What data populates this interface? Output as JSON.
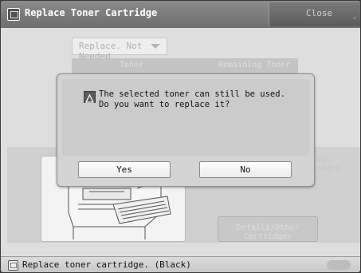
{
  "window": {
    "title": "Replace Toner Cartridge",
    "close_label": "Close"
  },
  "background": {
    "dropdown_value": "Replace. Not Needed",
    "column_toner": "Toner",
    "column_remaining": "Remaining Toner",
    "side_text": "ical orders",
    "details_button": "Details/Other Cartridges"
  },
  "dialog": {
    "line1": "The selected toner can still be used.",
    "line2": "Do you want to replace it?",
    "yes_label": "Yes",
    "no_label": "No"
  },
  "status": {
    "text": "Replace toner cartridge. (Black)"
  },
  "icons": [
    "replace-toner-icon",
    "warning-icon",
    "status-icon",
    "printer-illustration"
  ]
}
